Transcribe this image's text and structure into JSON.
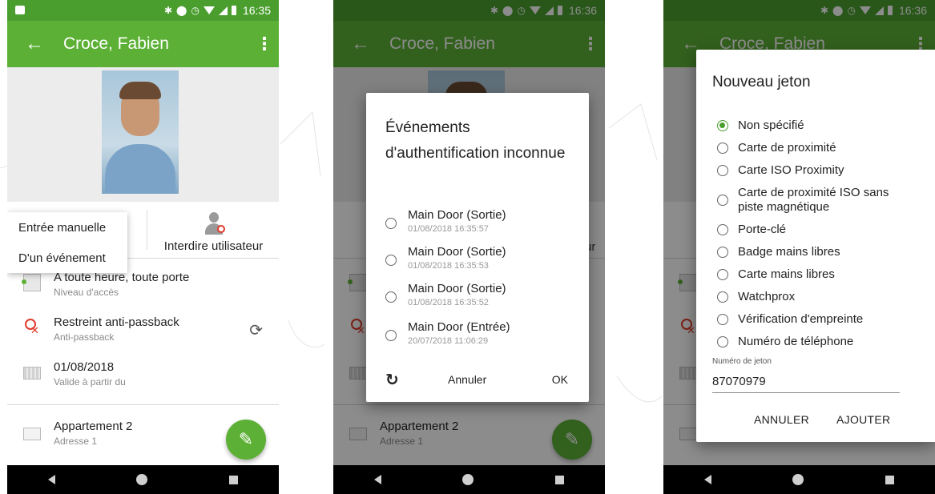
{
  "status_time_1": "16:35",
  "status_time_2": "16:36",
  "status_time_3": "16:36",
  "contact_name": "Croce, Fabien",
  "menu": {
    "manual_entry": "Entrée manuelle",
    "from_event": "D'un événement"
  },
  "ban_user_label": "Interdire utilisateur",
  "ban_user_peek": "ur",
  "rows": {
    "access": {
      "title": "A toute heure, toute porte",
      "subtitle": "Niveau d'accès"
    },
    "antipassback": {
      "title": "Restreint anti-passback",
      "subtitle": "Anti-passback"
    },
    "valid_from": {
      "title": "01/08/2018",
      "subtitle": "Valide à partir du"
    },
    "address": {
      "title": "Appartement 2",
      "subtitle": "Adresse 1"
    }
  },
  "auth_dialog": {
    "title": "Événements d'authentification inconnue",
    "events": [
      {
        "door": "Main Door (Sortie)",
        "timestamp": "01/08/2018 16:35:57"
      },
      {
        "door": "Main Door (Sortie)",
        "timestamp": "01/08/2018 16:35:53"
      },
      {
        "door": "Main Door (Sortie)",
        "timestamp": "01/08/2018 16:35:52"
      },
      {
        "door": "Main Door (Entrée)",
        "timestamp": "20/07/2018 11:06:29"
      }
    ],
    "cancel": "Annuler",
    "ok": "OK"
  },
  "token_dialog": {
    "title": "Nouveau jeton",
    "options": [
      "Non spécifié",
      "Carte de proximité",
      "Carte ISO Proximity",
      "Carte de proximité ISO sans piste magnétique",
      "Porte-clé",
      "Badge mains libres",
      "Carte mains libres",
      "Watchprox",
      "Vérification d'empreinte",
      "Numéro de téléphone"
    ],
    "selected_index": 0,
    "field_label": "Numéro de jeton",
    "field_value": "87070979",
    "cancel": "ANNULER",
    "add": "AJOUTER"
  },
  "colors": {
    "status_bar": "#4a9e2e",
    "app_bar": "#5cb035",
    "accent": "#4a9e2e",
    "danger": "#e03a2a"
  },
  "icons": {
    "back": "arrow-left-icon",
    "more": "more-vert-icon",
    "bluetooth": "bluetooth-icon",
    "dnd": "do-not-disturb-icon",
    "alarm": "alarm-icon",
    "wifi": "wifi-icon",
    "signal": "signal-icon",
    "battery": "battery-icon",
    "refresh": "refresh-icon",
    "sync": "sync-icon",
    "edit": "pencil-icon"
  }
}
